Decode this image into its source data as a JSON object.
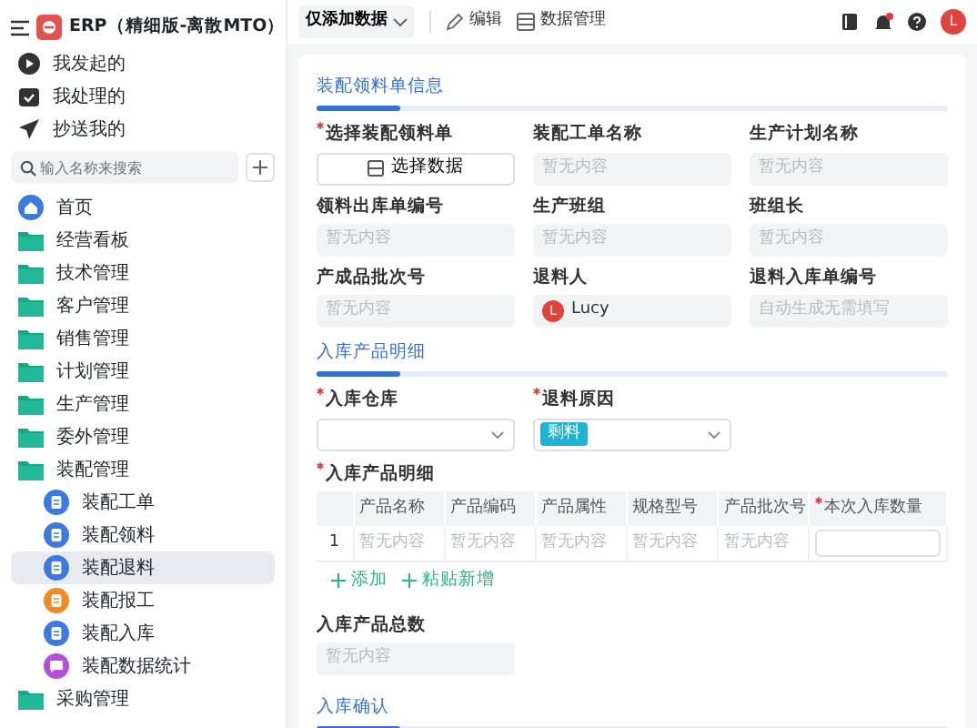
{
  "sidebar": {
    "title": "ERP（精细版-离散MTO）",
    "shortcuts": [
      {
        "label": "我发起的",
        "kind": "play"
      },
      {
        "label": "我处理的",
        "kind": "inbox"
      },
      {
        "label": "抄送我的",
        "kind": "send"
      }
    ],
    "search": {
      "placeholder": "输入名称来搜索"
    },
    "nav": [
      {
        "label": "首页",
        "kind": "home",
        "selected": false
      },
      {
        "label": "经营看板",
        "kind": "folder",
        "selected": false
      },
      {
        "label": "技术管理",
        "kind": "folder",
        "selected": false
      },
      {
        "label": "客户管理",
        "kind": "folder",
        "selected": false
      },
      {
        "label": "销售管理",
        "kind": "folder",
        "selected": false
      },
      {
        "label": "计划管理",
        "kind": "folder",
        "selected": false
      },
      {
        "label": "生产管理",
        "kind": "folder",
        "selected": false
      },
      {
        "label": "委外管理",
        "kind": "folder",
        "selected": false
      },
      {
        "label": "装配管理",
        "kind": "folder",
        "selected": false,
        "children": [
          {
            "label": "装配工单",
            "kind": "doc",
            "color": "#3b7be0",
            "selected": false
          },
          {
            "label": "装配领料",
            "kind": "doc",
            "color": "#3b7be0",
            "selected": false
          },
          {
            "label": "装配退料",
            "kind": "doc",
            "color": "#3b7be0",
            "selected": true
          },
          {
            "label": "装配报工",
            "kind": "doc",
            "color": "#f08a24",
            "selected": false
          },
          {
            "label": "装配入库",
            "kind": "doc",
            "color": "#3b7be0",
            "selected": false
          },
          {
            "label": "装配数据统计",
            "kind": "chat",
            "color": "#b44fd6",
            "selected": false
          }
        ]
      },
      {
        "label": "采购管理",
        "kind": "folder",
        "selected": false
      }
    ]
  },
  "toolbar": {
    "view": "仅添加数据",
    "actions": [
      {
        "label": "编辑",
        "kind": "edit"
      },
      {
        "label": "数据管理",
        "kind": "data"
      }
    ],
    "avatar": "L"
  },
  "sections": [
    {
      "title": "装配领料单信息",
      "fields": [
        {
          "label": "选择装配领料单",
          "required": true,
          "kind": "button",
          "value": "选择数据"
        },
        {
          "label": "装配工单名称",
          "required": false,
          "kind": "readonly",
          "placeholder": "暂无内容"
        },
        {
          "label": "生产计划名称",
          "required": false,
          "kind": "readonly",
          "placeholder": "暂无内容"
        },
        {
          "label": "领料出库单编号",
          "required": false,
          "kind": "readonly",
          "placeholder": "暂无内容"
        },
        {
          "label": "生产班组",
          "required": false,
          "kind": "readonly",
          "placeholder": "暂无内容"
        },
        {
          "label": "班组长",
          "required": false,
          "kind": "readonly",
          "placeholder": "暂无内容"
        },
        {
          "label": "产成品批次号",
          "required": false,
          "kind": "readonly",
          "placeholder": "暂无内容"
        },
        {
          "label": "退料人",
          "required": false,
          "kind": "user",
          "avatar": "L",
          "value": "Lucy"
        },
        {
          "label": "退料入库单编号",
          "required": false,
          "kind": "readonly",
          "placeholder": "自动生成无需填写"
        }
      ]
    },
    {
      "title": "入库产品明细",
      "fields": [
        {
          "label": "入库仓库",
          "required": true,
          "kind": "select"
        },
        {
          "label": "退料原因",
          "required": true,
          "kind": "select",
          "tag": "剩料"
        }
      ],
      "table": {
        "label": "入库产品明细",
        "required": true,
        "columns": [
          {
            "label": "产品名称",
            "required": false,
            "kind": "text"
          },
          {
            "label": "产品编码",
            "required": false,
            "kind": "text"
          },
          {
            "label": "产品属性",
            "required": false,
            "kind": "text"
          },
          {
            "label": "规格型号",
            "required": false,
            "kind": "text"
          },
          {
            "label": "产品批次号",
            "required": false,
            "kind": "text"
          },
          {
            "label": "本次入库数量",
            "required": true,
            "kind": "input"
          }
        ],
        "rows": [
          {
            "index": "1",
            "cells": [
              "暂无内容",
              "暂无内容",
              "暂无内容",
              "暂无内容",
              "暂无内容"
            ]
          }
        ],
        "actions": [
          "添加",
          "粘贴新增"
        ]
      },
      "after": [
        {
          "label": "入库产品总数",
          "required": false,
          "kind": "readonly",
          "placeholder": "暂无内容"
        }
      ]
    },
    {
      "title": "入库确认"
    }
  ]
}
